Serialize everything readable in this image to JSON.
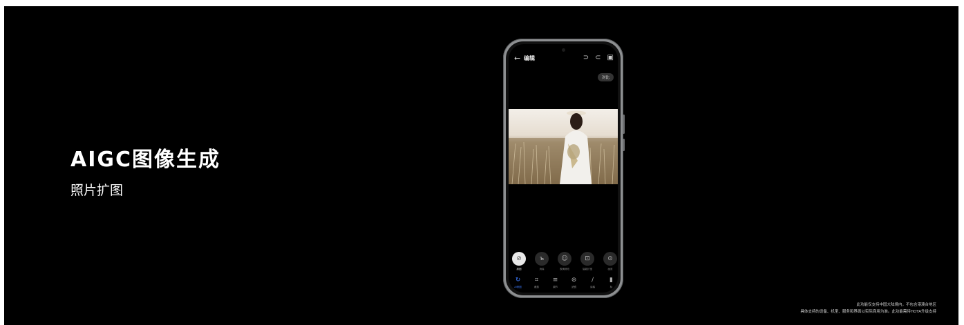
{
  "slide": {
    "title": "AIGC图像生成",
    "subtitle": "照片扩图",
    "footnote_line1": "此功能仅支持中国大陆境内，不包含港澳台地区",
    "footnote_line2": "具体支持的设备、机型、服务和界面以实际商用为准。此功能需待HOTA升级支持"
  },
  "phone": {
    "header": {
      "back_icon": "arrow-left-icon",
      "title": "编辑",
      "undo_icon": "undo-icon",
      "redo_icon": "redo-icon",
      "save_icon": "save-icon"
    },
    "compare_label": "对比",
    "tools": [
      {
        "icon": "block-icon",
        "label": "原图",
        "active": true
      },
      {
        "icon": "eraser-icon",
        "label": "消除"
      },
      {
        "icon": "face-icon",
        "label": "表情修改"
      },
      {
        "icon": "expand-icon",
        "label": "智能扩图"
      },
      {
        "icon": "settings-icon",
        "label": "画质"
      }
    ],
    "tabs": [
      {
        "icon": "ai-icon",
        "label": "AI修图",
        "active": true
      },
      {
        "icon": "crop-icon",
        "label": "裁剪"
      },
      {
        "icon": "adjust-icon",
        "label": "调节"
      },
      {
        "icon": "filter-icon",
        "label": "滤镜"
      },
      {
        "icon": "brush-icon",
        "label": "涂鸦"
      },
      {
        "icon": "more-icon",
        "label": "标"
      }
    ]
  },
  "colors": {
    "background": "#000000",
    "accent": "#3d7bff",
    "text": "#ffffff"
  }
}
